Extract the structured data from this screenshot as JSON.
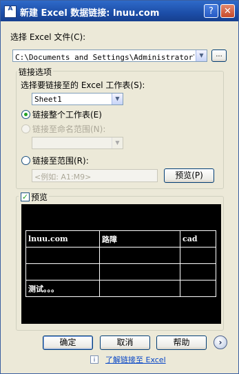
{
  "window": {
    "title": "新建 Excel 数据链接: lnuu.com",
    "help_button": "?",
    "close_button": "✕",
    "icon_text": "A"
  },
  "file": {
    "label": "选择 Excel 文件(C):",
    "path": "C:\\Documents and Settings\\Administrator\\桌面",
    "browse_label": "..."
  },
  "link_options": {
    "group_title": "链接选项",
    "sheet_label": "选择要链接至的 Excel 工作表(S):",
    "sheet_value": "Sheet1",
    "radio_whole_sheet": "链接整个工作表(E)",
    "radio_named_range": "链接至命名范围(N):",
    "radio_range": "链接至范围(R):",
    "range_placeholder": "<例如: A1:M9>",
    "preview_button": "预览(P)",
    "selected": "whole_sheet"
  },
  "preview": {
    "checkbox_label": "预览",
    "checked": true,
    "table": [
      [
        "lnuu.com",
        "路障",
        "cad"
      ],
      [
        "",
        "",
        ""
      ],
      [
        "",
        "",
        ""
      ],
      [
        "测试。。。",
        "",
        ""
      ]
    ]
  },
  "buttons": {
    "ok": "确定",
    "cancel": "取消",
    "help": "帮助",
    "expand": "›"
  },
  "footer": {
    "info_icon": "i",
    "link_text": "了解链接至 Excel"
  },
  "colors": {
    "titlebar": "#1c4ea8",
    "dialog_bg": "#ece9d8",
    "preview_bg": "#000000",
    "link": "#0645c6"
  }
}
